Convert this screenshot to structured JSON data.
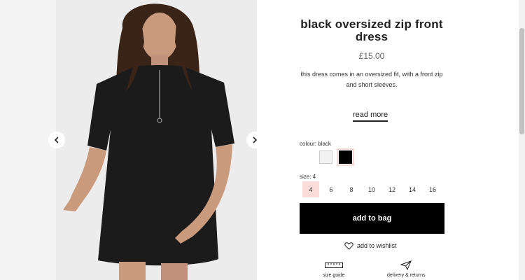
{
  "product": {
    "title": "black oversized zip front dress",
    "price": "£15.00",
    "description": "this dress comes in an oversized fit, with a front zip and short sleeves.",
    "read_more": "read more"
  },
  "colour": {
    "label": "colour: black",
    "options": [
      {
        "name": "white",
        "hex": "#f2f2f2"
      },
      {
        "name": "black",
        "hex": "#000000",
        "selected": true
      }
    ]
  },
  "size": {
    "label": "size: 4",
    "options": [
      "4",
      "6",
      "8",
      "10",
      "12",
      "14",
      "16"
    ],
    "selected": "4"
  },
  "actions": {
    "add_to_bag": "add to bag",
    "wishlist": "add to wishlist"
  },
  "services": [
    {
      "icon": "ruler-icon",
      "label": "size guide"
    },
    {
      "icon": "paper-plane-icon",
      "label": "delivery & returns"
    }
  ],
  "colors": {
    "selected_size_bg": "#fbdcd8",
    "button_bg": "#000000",
    "photo_bg": "#ededed"
  }
}
